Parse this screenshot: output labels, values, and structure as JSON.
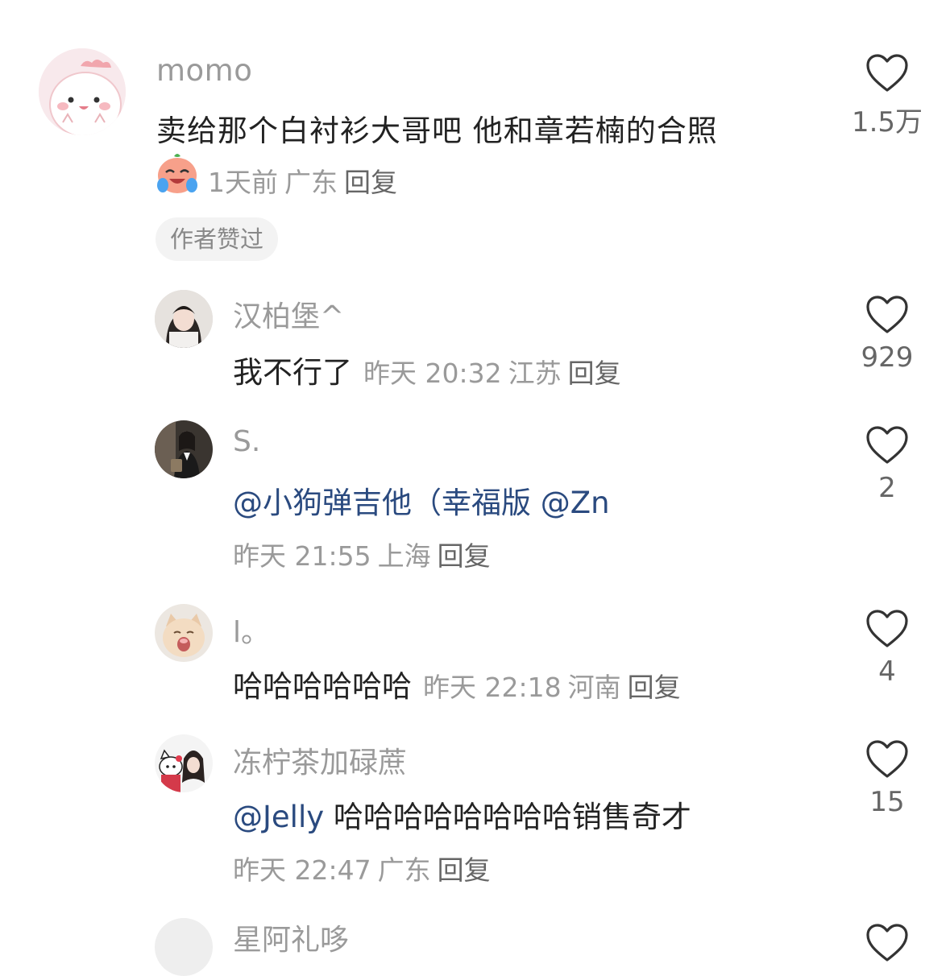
{
  "comments": [
    {
      "username": "momo",
      "content": "卖给那个白衬衫大哥吧 他和章若楠的合照",
      "time": "1天前",
      "location": "广东",
      "reply_label": "回复",
      "author_liked": "作者赞过",
      "likes": "1.5万",
      "avatar": "pink-cartoon-avatar",
      "badge": "laughing-crying-emoji"
    },
    {
      "username": "汉柏堡^",
      "content": "我不行了",
      "time": "昨天 20:32",
      "location": "江苏",
      "reply_label": "回复",
      "likes": "929",
      "avatar": "girl-photo-avatar"
    },
    {
      "username": "S.",
      "mention": "@小狗弹吉他（幸福版 @Zn",
      "time": "昨天 21:55",
      "location": "上海",
      "reply_label": "回复",
      "likes": "2",
      "avatar": "girl-suit-avatar"
    },
    {
      "username": "l。",
      "content": "哈哈哈哈哈哈",
      "time": "昨天 22:18",
      "location": "河南",
      "reply_label": "回复",
      "likes": "4",
      "avatar": "cat-avatar"
    },
    {
      "username": "冻柠茶加碌蔗",
      "mention": "@Jelly",
      "content": " 哈哈哈哈哈哈哈哈销售奇才",
      "time": "昨天 22:47",
      "location": "广东",
      "reply_label": "回复",
      "likes": "15",
      "avatar": "girl-hellokitty-avatar"
    }
  ],
  "partial_next_username": "星阿礼哆",
  "colors": {
    "username": "#9a9a9a",
    "mention": "#2a4a7f",
    "text": "#222222",
    "meta": "#9a9a9a",
    "like_icon": "#333333",
    "pill_bg": "#f3f3f3"
  }
}
